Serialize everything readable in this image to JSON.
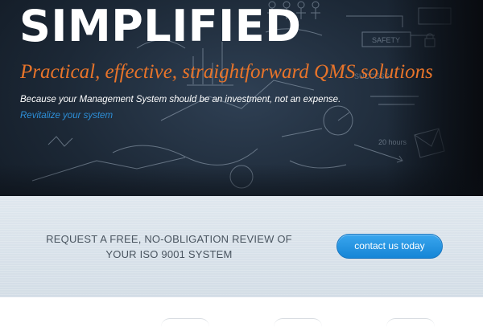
{
  "hero": {
    "title": "SIMPLIFIED",
    "subtitle": "Practical, effective, straightforward QMS solutions",
    "tagline": "Because your Management System should be an investment, not an expense.",
    "link_text": "Revitalize your system",
    "sketch_labels": [
      "SAFETY",
      "SUCCESS",
      "20 hours"
    ],
    "colors": {
      "subtitle": "#e8742a",
      "link": "#2d8fd8"
    }
  },
  "cta": {
    "text_line1": "REQUEST A FREE, NO-OBLIGATION REVIEW OF",
    "text_line2": "YOUR ISO 9001 SYSTEM",
    "button_label": "contact us today",
    "colors": {
      "button": "#1e90e0"
    }
  }
}
